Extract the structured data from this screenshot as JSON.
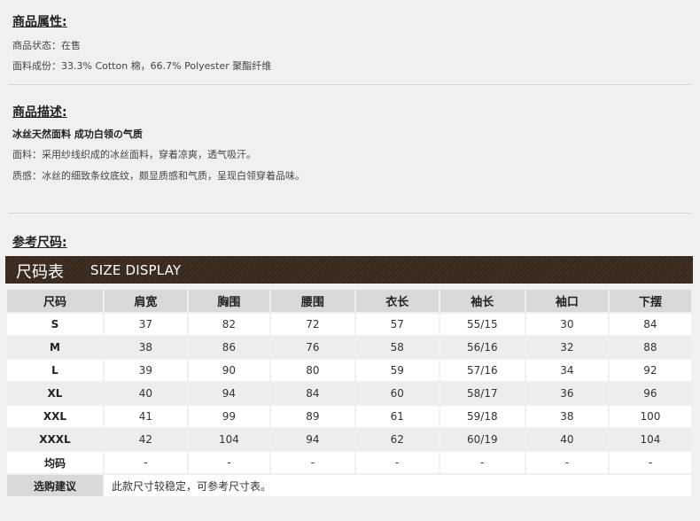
{
  "attributes": {
    "title": "商品属性:",
    "status_label": "商品状态：",
    "status_value": "在售",
    "fabric_label": "面料成份：",
    "fabric_value": "33.3% Cotton 棉，66.7% Polyester 聚酯纤维"
  },
  "description": {
    "title": "商品描述:",
    "headline": "冰丝天然面料 成功白领の气质",
    "fabric_label": "面料：",
    "fabric_text": "采用纱线织成的冰丝面料，穿着凉爽，透气吸汗。",
    "feel_label": "质感：",
    "feel_text": "冰丝的细致条纹底纹，颇显质感和气质，呈现白领穿着品味。"
  },
  "size_ref": {
    "title": "参考尺码:",
    "banner_zh": "尺码表",
    "banner_en": "SIZE DISPLAY"
  },
  "size_table": {
    "headers": [
      "尺码",
      "肩宽",
      "胸围",
      "腰围",
      "衣长",
      "袖长",
      "袖口",
      "下摆"
    ],
    "rows": [
      [
        "S",
        "37",
        "82",
        "72",
        "57",
        "55/15",
        "30",
        "84"
      ],
      [
        "M",
        "38",
        "86",
        "76",
        "58",
        "56/16",
        "32",
        "88"
      ],
      [
        "L",
        "39",
        "90",
        "80",
        "59",
        "57/16",
        "34",
        "92"
      ],
      [
        "XL",
        "40",
        "94",
        "84",
        "60",
        "58/17",
        "36",
        "96"
      ],
      [
        "XXL",
        "41",
        "99",
        "89",
        "61",
        "59/18",
        "38",
        "100"
      ],
      [
        "XXXL",
        "42",
        "104",
        "94",
        "62",
        "60/19",
        "40",
        "104"
      ],
      [
        "均码",
        "-",
        "-",
        "-",
        "-",
        "-",
        "-",
        "-"
      ]
    ],
    "advice_label": "选购建议",
    "advice_text": "此款尺寸较稳定，可参考尺寸表。"
  }
}
